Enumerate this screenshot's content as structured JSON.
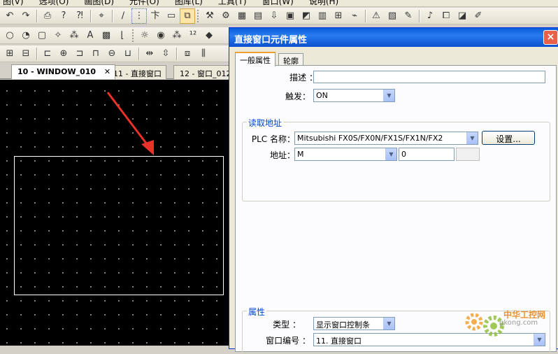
{
  "menu": [
    "图(V)",
    "选项(O)",
    "画图(D)",
    "元件(O)",
    "图库(L)",
    "工具(T)",
    "窗口(W)",
    "说明(H)"
  ],
  "toolbar_icons": {
    "row1": [
      "undo-icon",
      "redo-icon",
      "print-icon",
      "help-icon",
      "whats-this-icon",
      "pointer-icon",
      "line-icon",
      "grid-icon",
      "text-icon",
      "rectangle-icon",
      "window-icon",
      "tools-icon",
      "compile-icon",
      "online-simulate-icon",
      "offline-simulate-icon",
      "download-icon",
      "screen-icon",
      "chart-icon",
      "table-icon",
      "recipe-icon",
      "plug-icon",
      "alarm-icon",
      "log-icon",
      "sound-icon",
      "message-icon",
      "note-icon"
    ],
    "row2": [
      "circle-icon",
      "pie-icon",
      "round-rect-icon",
      "polygon-icon",
      "text-A-icon",
      "image-icon",
      "lamp-icon",
      "traffic-light-icon",
      "numeric-icon",
      "ascii-icon",
      "shape-icon"
    ],
    "row3": [
      "group-icon",
      "ungroup-icon",
      "align-left-icon",
      "align-center-icon",
      "align-right-icon",
      "align-top-icon",
      "align-middle-icon",
      "align-bottom-icon",
      "same-width-icon",
      "same-height-icon",
      "same-size-icon"
    ]
  },
  "document_tabs": [
    {
      "label": "10 - WINDOW_010",
      "active": true,
      "closable": true
    },
    {
      "label": "11 - 直接窗口",
      "active": false
    },
    {
      "label": "12 - 窗口_012",
      "active": false
    }
  ],
  "dialog": {
    "title": "直接窗口元件属性",
    "close_label": "×",
    "tabs": [
      {
        "label": "一般属性",
        "active": true
      },
      {
        "label": "轮廓",
        "active": false
      }
    ],
    "description_label": "描述 ：",
    "description_value": "",
    "trigger_label": "触发：",
    "trigger_value": "ON",
    "read_address": {
      "caption": "读取地址",
      "plc_label": "PLC 名称：",
      "plc_value": "Mitsubishi FX0S/FX0N/FX1S/FX1N/FX2",
      "settings_button": "设置...",
      "address_label": "地址：",
      "device_value": "M",
      "address_value": "0"
    },
    "attributes": {
      "caption": "属性",
      "type_label": "类型 ：",
      "type_value": "显示窗口控制条",
      "window_no_label": "窗口编号 ：",
      "window_no_value": "11. 直接窗口"
    }
  },
  "watermark": {
    "cn": "中华工控网",
    "en": "gkong.com"
  },
  "colors": {
    "canvas": "#000000",
    "title_bar": "#0a5bd8",
    "group_caption": "#0046d5",
    "annotation_arrow": "#e8322a"
  }
}
